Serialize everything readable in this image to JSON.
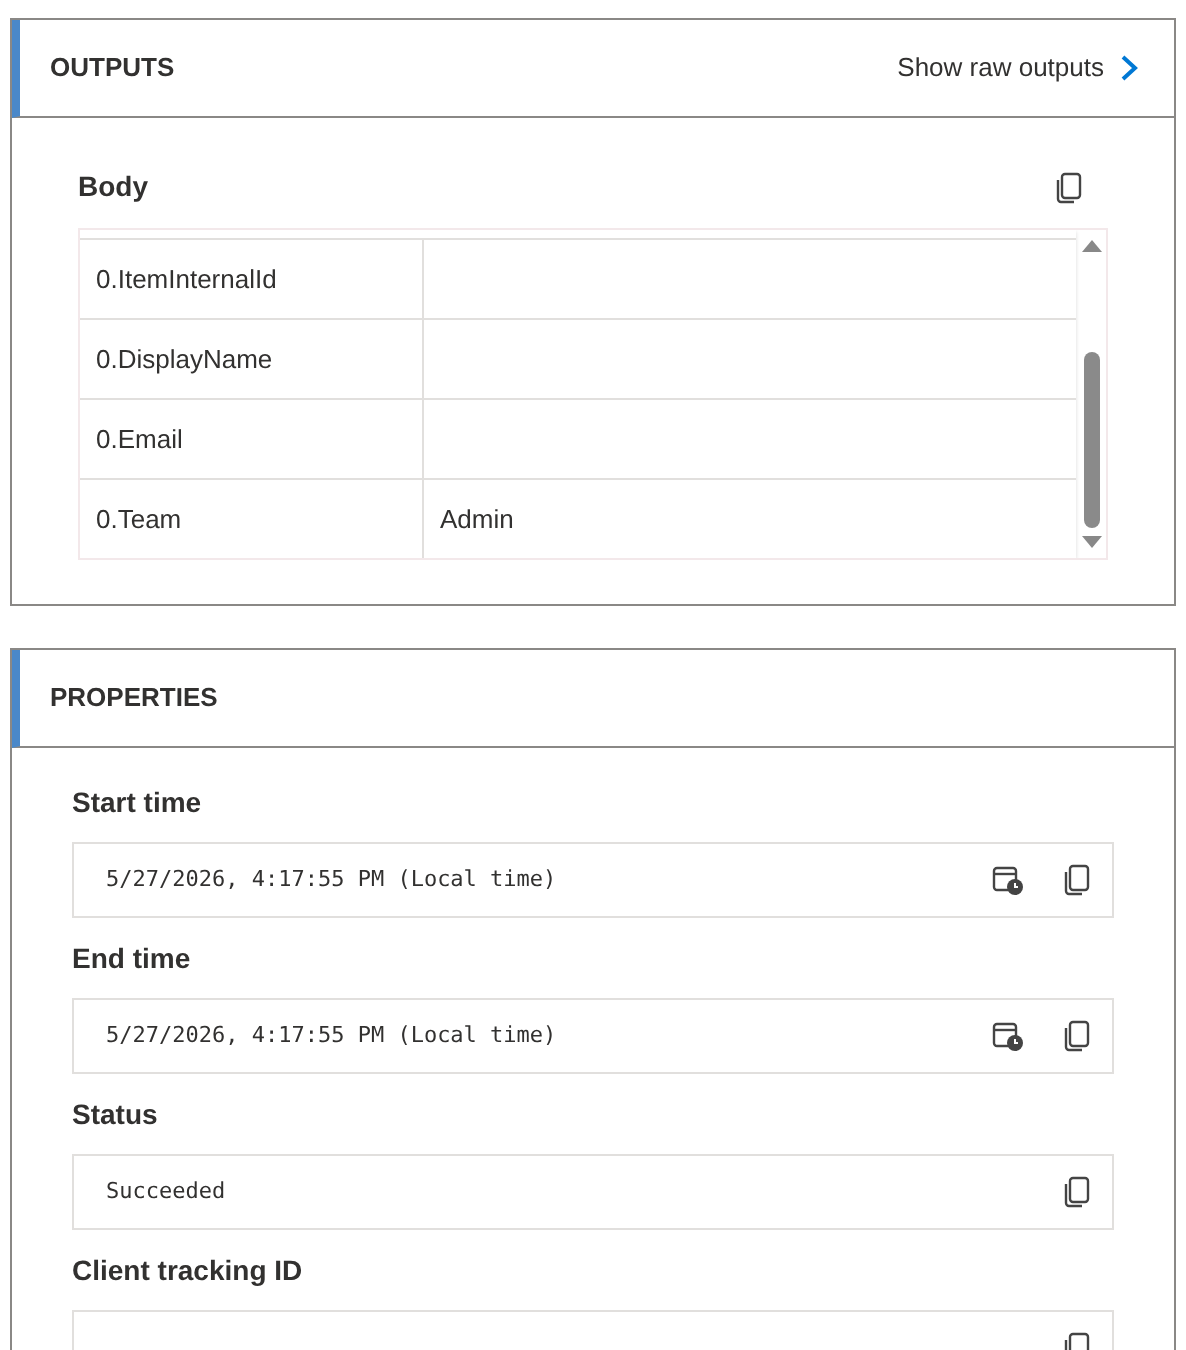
{
  "outputs": {
    "title": "OUTPUTS",
    "raw_link": "Show raw outputs",
    "body": {
      "label": "Body",
      "rows": [
        {
          "key": "0.ItemInternalId"
        },
        {
          "key": "0.DisplayName"
        },
        {
          "key": "0.Email"
        },
        {
          "key": "0.Team",
          "value": "Admin"
        }
      ]
    }
  },
  "properties": {
    "title": "PROPERTIES",
    "fields": [
      {
        "label": "Start time",
        "kind": "datetime",
        "value": "5/27/2026, 4:17:55 PM (Local time)"
      },
      {
        "label": "End time",
        "kind": "datetime",
        "value": "5/27/2026, 4:17:55 PM (Local time)"
      },
      {
        "label": "Status",
        "kind": "text",
        "value": "Succeeded"
      },
      {
        "label": "Client tracking ID",
        "kind": "text"
      }
    ]
  }
}
